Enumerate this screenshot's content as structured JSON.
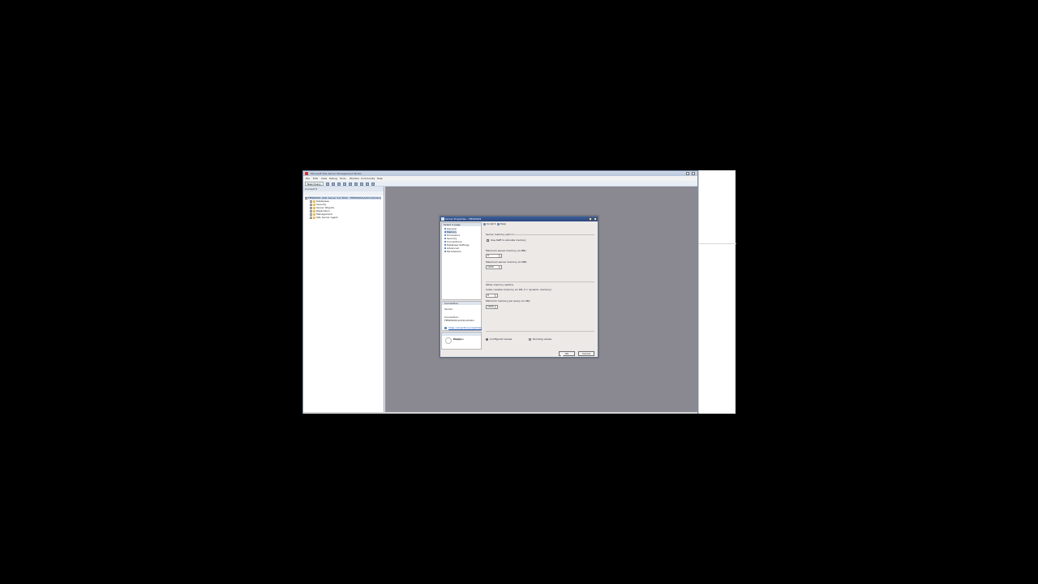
{
  "app": {
    "title": "Microsoft SQL Server Management Studio",
    "menu": [
      "File",
      "Edit",
      "View",
      "Debug",
      "Tools",
      "Window",
      "Community",
      "Help"
    ],
    "new_query_label": "New Query"
  },
  "object_explorer": {
    "header": "Connect ▾",
    "root": "FMSP0001 (SQL Server 9.0.3042 - FMSP0001\\Administrator)",
    "nodes": [
      "Databases",
      "Security",
      "Server Objects",
      "Replication",
      "Management",
      "SQL Server Agent"
    ]
  },
  "dialog": {
    "title": "Server Properties - FMSP0001",
    "select_page_header": "Select a page",
    "pages": [
      "General",
      "Memory",
      "Processors",
      "Security",
      "Connections",
      "Database Settings",
      "Advanced",
      "Permissions"
    ],
    "selected_page": "Memory",
    "toolbar": {
      "script": "Script ▾",
      "help": "Help"
    },
    "connection": {
      "header": "Connection",
      "server_label": "Server:",
      "connection_label": "Connection:",
      "connection_value": "FMSP0001\\Administrator",
      "link": "View connection properties"
    },
    "progress": {
      "header": "Progress",
      "status": "Ready"
    },
    "server_memory": {
      "group_title": "Server memory options",
      "awe_label": "Use AWE to allocate memory",
      "min_label": "Minimum server memory (in MB):",
      "min_value": "0",
      "max_label": "Maximum server memory (in MB):",
      "max_value": "1024"
    },
    "other_memory": {
      "group_title": "Other memory options",
      "index_label": "Index creation memory (in KB, 0 = dynamic memory):",
      "index_value": "0",
      "query_label": "Minimum memory per query (in KB):",
      "query_value": "1024"
    },
    "values_options": {
      "configured": "Configured values",
      "running": "Running values",
      "selected": "configured"
    },
    "buttons": {
      "ok": "OK",
      "cancel": "Cancel"
    }
  },
  "colors": {
    "workspace": "#8a8890",
    "dialog_title": "#2a4780",
    "background": "#000000"
  }
}
